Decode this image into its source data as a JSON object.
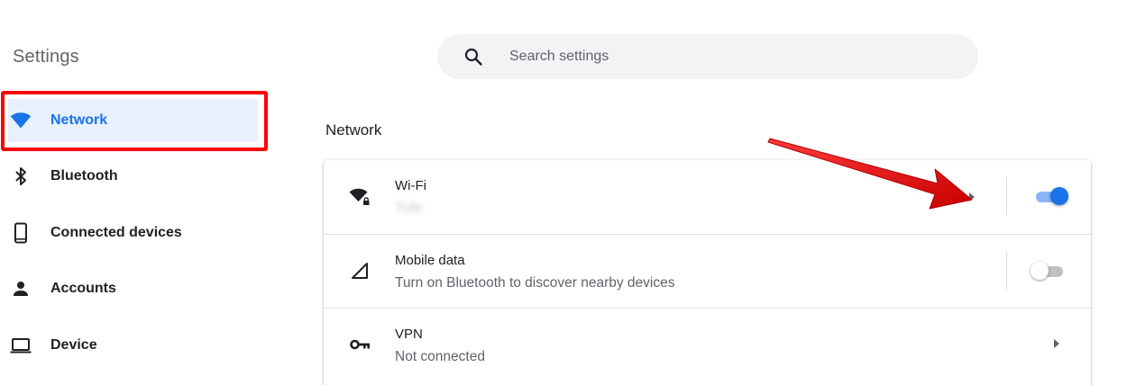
{
  "app": {
    "title": "Settings"
  },
  "search": {
    "placeholder": "Search settings",
    "icon": "search-icon"
  },
  "sidebar": {
    "items": [
      {
        "label": "Network",
        "icon": "wifi-icon",
        "active": true
      },
      {
        "label": "Bluetooth",
        "icon": "bluetooth-icon",
        "active": false
      },
      {
        "label": "Connected devices",
        "icon": "phone-icon",
        "active": false
      },
      {
        "label": "Accounts",
        "icon": "person-icon",
        "active": false
      },
      {
        "label": "Device",
        "icon": "laptop-icon",
        "active": false
      }
    ]
  },
  "main": {
    "section_title": "Network",
    "rows": [
      {
        "title": "Wi-Fi",
        "subtitle": "Tufe",
        "icon": "wifi-lock-icon",
        "toggle": true
      },
      {
        "title": "Mobile data",
        "subtitle": "Turn on Bluetooth to discover nearby devices",
        "icon": "cellular-signal-icon",
        "toggle": false
      },
      {
        "title": "VPN",
        "subtitle": "Not connected",
        "icon": "vpn-key-icon"
      }
    ]
  },
  "colors": {
    "accent": "#1a73e8",
    "active_bg": "#e8f0fe",
    "highlight": "#ff0000",
    "annotation_arrow": "#e00000"
  }
}
